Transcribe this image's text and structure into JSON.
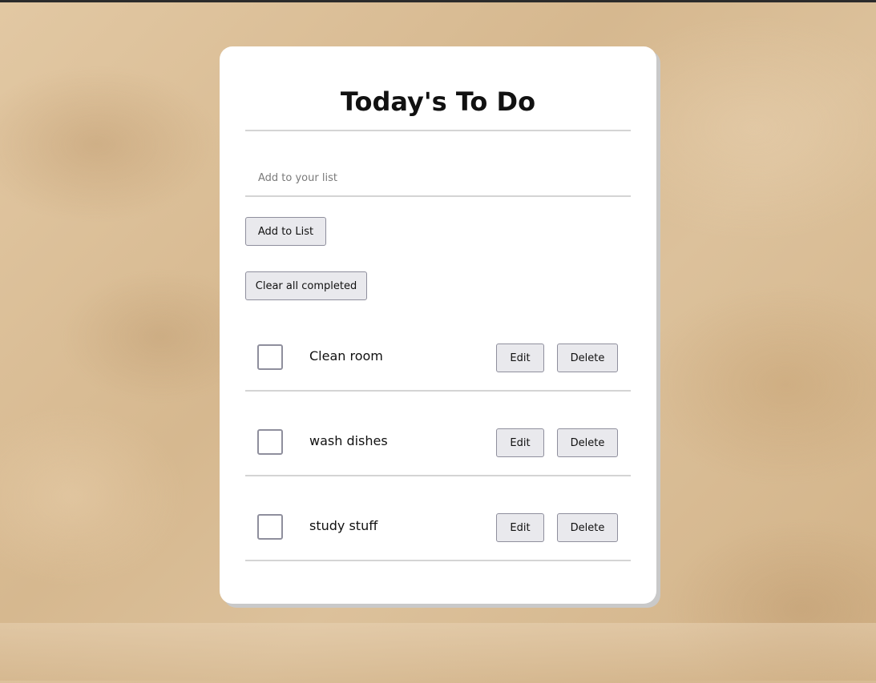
{
  "app": {
    "title": "Today's To Do"
  },
  "input": {
    "placeholder": "Add to your list",
    "value": ""
  },
  "buttons": {
    "add_label": "Add to List",
    "clear_label": "Clear all completed",
    "edit_label": "Edit",
    "delete_label": "Delete"
  },
  "todos": [
    {
      "text": "Clean room",
      "completed": false
    },
    {
      "text": "wash dishes",
      "completed": false
    },
    {
      "text": "study stuff",
      "completed": false
    }
  ],
  "colors": {
    "card_background": "#ffffff",
    "page_background": "#dcc09a",
    "button_background": "#e9e9ed",
    "button_border": "#8f8f9d",
    "divider": "#d4d4d4"
  }
}
